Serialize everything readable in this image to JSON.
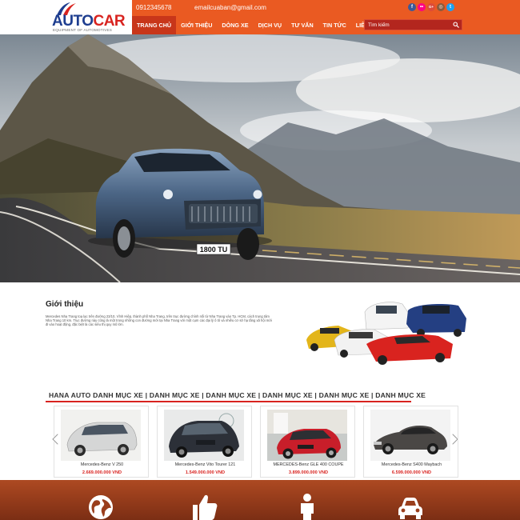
{
  "brand": {
    "name_part1": "AUTO",
    "name_part2": "CAR",
    "tagline": "EQUIPMENT OF AUTOMOTIVES"
  },
  "contact": {
    "phone": "0912345678",
    "email": "emailcuaban@gmail.com"
  },
  "socials": [
    {
      "icon": "facebook-icon",
      "glyph": "f",
      "color": "#3b5998"
    },
    {
      "icon": "flickr-icon",
      "glyph": "••",
      "color": "#ff0084"
    },
    {
      "icon": "google-plus-icon",
      "glyph": "G+",
      "color": "#dd4b39"
    },
    {
      "icon": "instagram-icon",
      "glyph": "◎",
      "color": "#8a5a3c"
    },
    {
      "icon": "twitter-icon",
      "glyph": "t",
      "color": "#1da1f2"
    }
  ],
  "nav": [
    {
      "label": "TRANG CHỦ",
      "active": true
    },
    {
      "label": "GIỚI THIỆU",
      "active": false
    },
    {
      "label": "DÒNG XE",
      "active": false
    },
    {
      "label": "DỊCH VỤ",
      "active": false
    },
    {
      "label": "TƯ VẤN",
      "active": false
    },
    {
      "label": "TIN TỨC",
      "active": false
    },
    {
      "label": "LIÊN HỆ",
      "active": false
    }
  ],
  "search": {
    "placeholder": "Tìm kiếm"
  },
  "hero": {
    "plate": "1800 TU"
  },
  "intro": {
    "title": "Giới thiệu",
    "text": "Mercedes Nha Trang toạ lạc trên đường 23/10, Vĩnh Hiệp, thành phố Nha Trang, trên trục đường chính nối từ Nha Trang vào Tp. HCM, cách trung tâm Nha Trang 10 km. Trục đường này cũng là một trong những con đường mới tại Nha Trang với một cụm các đại lý ô tô và nhiều cơ sở hạ tầng xã hội mới đi vào hoạt động, đặc biệt là các siêu thị quy mô lớn."
  },
  "category": {
    "title": "HANA AUTO DANH MỤC XE | DANH MỤC XE | DANH MỤC XE | DANH MỤC XE | DANH MỤC XE | DANH MỤC XE"
  },
  "products": [
    {
      "name": "Mercedes-Benz V 250",
      "price": "2.669.000.000 VND",
      "color": "#d8d8d8"
    },
    {
      "name": "Mercedes-Benz Vito Tourer 121",
      "price": "1.549.000.000 VND",
      "color": "#2b2f36"
    },
    {
      "name": "MERCEDES-Benz GLE 400 COUPE",
      "price": "3.899.000.000 VND",
      "color": "#c81e2a"
    },
    {
      "name": "Mercedes-Benz S400 Maybach",
      "price": "6.599.000.000 VND",
      "color": "#4a4745"
    }
  ],
  "features": [
    {
      "icon": "globe-icon"
    },
    {
      "icon": "thumbs-up-icon"
    },
    {
      "icon": "person-icon"
    },
    {
      "icon": "car-icon"
    }
  ],
  "colors": {
    "header": "#ea5a22",
    "nav_active": "#c8361a",
    "accent_red": "#d8231f",
    "logo_blue": "#1d3d8f",
    "footer": "#9a3e1c"
  }
}
